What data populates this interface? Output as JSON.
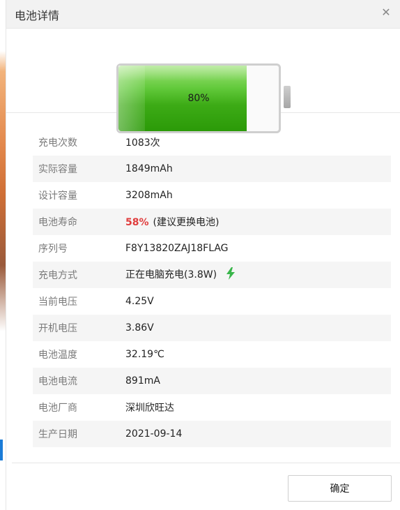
{
  "dialog": {
    "title": "电池详情",
    "close_icon": "close-icon",
    "battery": {
      "percent_text": "80%",
      "fill_fraction": 0.8
    },
    "details": [
      {
        "label": "充电次数",
        "value": "1083次"
      },
      {
        "label": "实际容量",
        "value": "1849mAh"
      },
      {
        "label": "设计容量",
        "value": "3208mAh"
      },
      {
        "label": "电池寿命",
        "health": "58%",
        "value": "(建议更换电池)"
      },
      {
        "label": "序列号",
        "value": "F8Y13820ZAJ18FLAG"
      },
      {
        "label": "充电方式",
        "value": "正在电脑充电(3.8W)",
        "icon": "lightning-bolt-icon"
      },
      {
        "label": "当前电压",
        "value": "4.25V"
      },
      {
        "label": "开机电压",
        "value": "3.86V"
      },
      {
        "label": "电池温度",
        "value": "32.19℃"
      },
      {
        "label": "电池电流",
        "value": "891mA"
      },
      {
        "label": "电池厂商",
        "value": "深圳欣旺达"
      },
      {
        "label": "生产日期",
        "value": "2021-09-14"
      }
    ],
    "confirm_label": "确定"
  },
  "colors": {
    "health_warning": "#e03d3d",
    "battery_green": "#3dab16",
    "bolt_green": "#39b54a"
  }
}
